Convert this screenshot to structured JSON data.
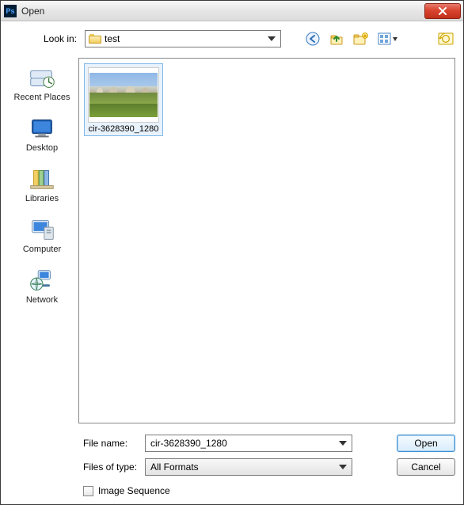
{
  "titlebar": {
    "title": "Open"
  },
  "lookin": {
    "label": "Look in:",
    "value": "test"
  },
  "nav": {
    "back": "back-icon",
    "up": "up-one-level-icon",
    "newfolder": "new-folder-icon",
    "viewmenu": "view-menu-icon",
    "lastchanged": "last-changed-icon"
  },
  "places": [
    {
      "label": "Recent Places"
    },
    {
      "label": "Desktop"
    },
    {
      "label": "Libraries"
    },
    {
      "label": "Computer"
    },
    {
      "label": "Network"
    }
  ],
  "files": [
    {
      "name": "cir-3628390_1280"
    }
  ],
  "filename": {
    "label": "File name:",
    "value": "cir-3628390_1280"
  },
  "filetype": {
    "label": "Files of type:",
    "value": "All Formats"
  },
  "buttons": {
    "open": "Open",
    "cancel": "Cancel"
  },
  "image_sequence": {
    "label": "Image Sequence",
    "checked": false
  }
}
